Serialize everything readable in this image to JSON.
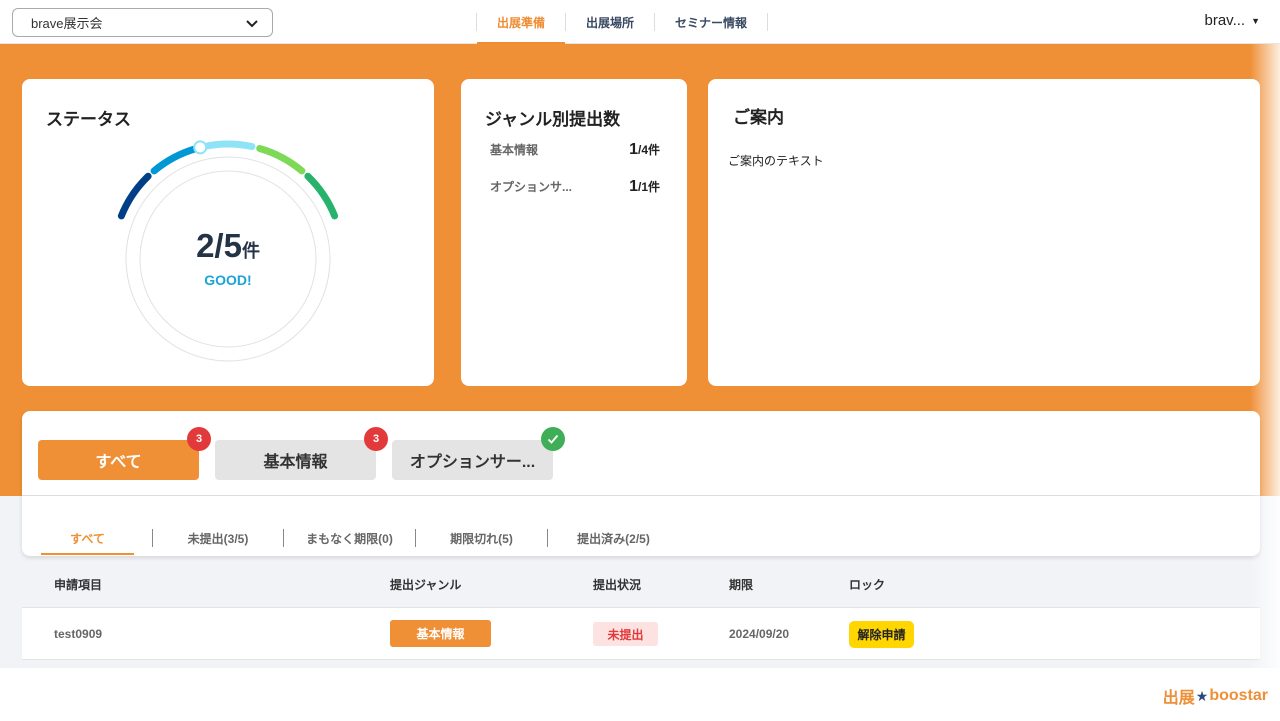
{
  "header": {
    "event_select": "brave展示会",
    "nav": [
      "出展準備",
      "出展場所",
      "セミナー情報"
    ],
    "active_nav": "出展準備",
    "user_name": "brav..."
  },
  "status": {
    "title": "ステータス",
    "count": "2/5",
    "unit": "件",
    "label": "GOOD!",
    "submitted": 2,
    "total": 5,
    "colors": [
      "#003f88",
      "#0098d4",
      "#8fe3f6",
      "#7ed957",
      "#27b36b"
    ]
  },
  "genre": {
    "title": "ジャンル別提出数",
    "rows": [
      {
        "name": "基本情報",
        "done": "1",
        "total": "/4件"
      },
      {
        "name": "オプションサ...",
        "done": "1",
        "total": "/1件"
      }
    ]
  },
  "info": {
    "title": "ご案内",
    "text": "ご案内のテキスト"
  },
  "genre_tabs": [
    {
      "label": "すべて",
      "badge": "3",
      "active": true
    },
    {
      "label": "基本情報",
      "badge": "3",
      "active": false
    },
    {
      "label": "オプションサー...",
      "badge_icon": "check-icon",
      "active": false
    }
  ],
  "status_tabs": [
    "すべて",
    "未提出(3/5)",
    "まもなく期限(0)",
    "期限切れ(5)",
    "提出済み(2/5)"
  ],
  "table": {
    "headers": [
      "申請項目",
      "提出ジャンル",
      "提出状況",
      "期限",
      "ロック"
    ],
    "rows": [
      {
        "item": "test0909",
        "genre": "基本情報",
        "status": "未提出",
        "deadline": "2024/09/20",
        "lock": "解除申請"
      }
    ]
  },
  "footer": {
    "logo_left": "出展",
    "logo_right": "boostar"
  },
  "accent": "#ef8f36"
}
